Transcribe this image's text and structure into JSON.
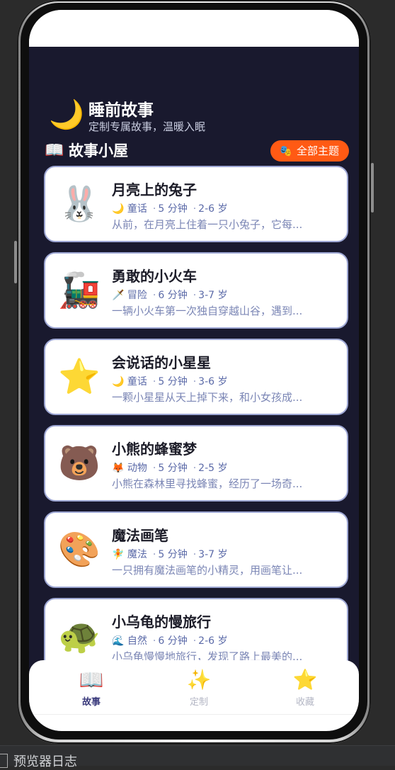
{
  "header": {
    "moon_icon": "🌙",
    "title": "睡前故事",
    "subtitle": "定制专属故事，温暖入眠"
  },
  "section": {
    "icon": "📖",
    "title": "故事小屋",
    "all_topics_icon": "🎭",
    "all_topics_label": "全部主题"
  },
  "stories": [
    {
      "emoji": "🐰",
      "title": "月亮上的兔子",
      "tag_icon": "🌙",
      "tag": "童话",
      "time": "5 分钟",
      "age": "2-6 岁",
      "desc": "从前，在月亮上住着一只小兔子，它每..."
    },
    {
      "emoji": "🚂",
      "title": "勇敢的小火车",
      "tag_icon": "🗡️",
      "tag": "冒险",
      "time": "6 分钟",
      "age": "3-7 岁",
      "desc": "一辆小火车第一次独自穿越山谷，遇到..."
    },
    {
      "emoji": "⭐",
      "title": "会说话的小星星",
      "tag_icon": "🌙",
      "tag": "童话",
      "time": "5 分钟",
      "age": "3-6 岁",
      "desc": "一颗小星星从天上掉下来，和小女孩成..."
    },
    {
      "emoji": "🐻",
      "title": "小熊的蜂蜜梦",
      "tag_icon": "🦊",
      "tag": "动物",
      "time": "5 分钟",
      "age": "2-5 岁",
      "desc": "小熊在森林里寻找蜂蜜，经历了一场奇..."
    },
    {
      "emoji": "🎨",
      "title": "魔法画笔",
      "tag_icon": "🧚",
      "tag": "魔法",
      "time": "5 分钟",
      "age": "3-7 岁",
      "desc": "一只拥有魔法画笔的小精灵，用画笔让..."
    },
    {
      "emoji": "🐢",
      "title": "小乌龟的慢旅行",
      "tag_icon": "🌊",
      "tag": "自然",
      "time": "6 分钟",
      "age": "2-6 岁",
      "desc": "小乌龟慢慢地旅行，发现了路上最美的..."
    }
  ],
  "tabbar": [
    {
      "icon": "📖",
      "label": "故事",
      "active": true
    },
    {
      "icon": "✨",
      "label": "定制",
      "active": false
    },
    {
      "icon": "⭐",
      "label": "收藏",
      "active": false
    }
  ],
  "ide": {
    "log_label": "预览器日志"
  }
}
